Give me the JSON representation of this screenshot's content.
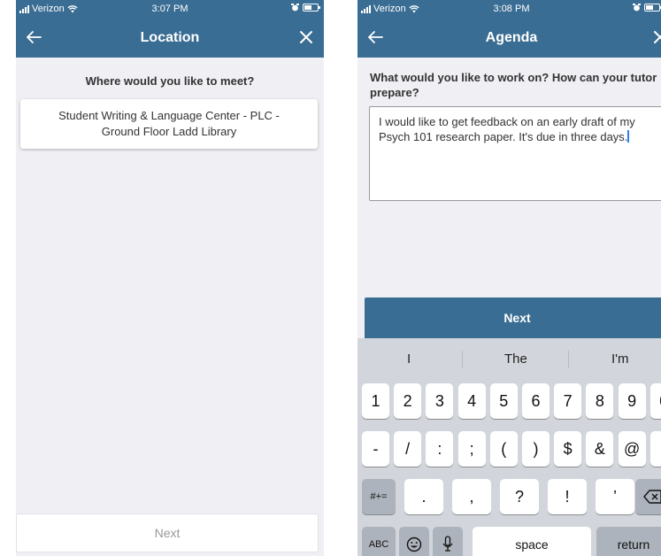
{
  "left_screen": {
    "status": {
      "carrier": "Verizon",
      "time": "3:07 PM"
    },
    "title": "Location",
    "question": "Where would you like to meet?",
    "location_line1": "Student Writing & Language Center - PLC -",
    "location_line2": "Ground Floor Ladd Library",
    "next_label": "Next"
  },
  "right_screen": {
    "status": {
      "carrier": "Verizon",
      "time": "3:08 PM"
    },
    "title": "Agenda",
    "question": "What would you like to work on? How can your tutor prepare?",
    "agenda_text": "I would like to get feedback on an early draft of my Psych 101 research paper. It's due in three days.",
    "next_label": "Next",
    "keyboard": {
      "suggestions": [
        "I",
        "The",
        "I'm"
      ],
      "row1": [
        "1",
        "2",
        "3",
        "4",
        "5",
        "6",
        "7",
        "8",
        "9",
        "0"
      ],
      "row2": [
        "-",
        "/",
        ":",
        ";",
        "(",
        ")",
        "$",
        "&",
        "@",
        "”"
      ],
      "row3_left": "#+=",
      "row3": [
        ".",
        ",",
        "?",
        "!",
        "’"
      ],
      "abc": "ABC",
      "space": "space",
      "return": "return"
    }
  },
  "colors": {
    "header": "#3a6d93",
    "background": "#efeff4",
    "caret": "#2f7cf6"
  },
  "icons": [
    "back-arrow-icon",
    "close-icon",
    "wifi-icon",
    "alarm-icon",
    "battery-icon",
    "emoji-icon",
    "microphone-icon",
    "backspace-icon"
  ]
}
